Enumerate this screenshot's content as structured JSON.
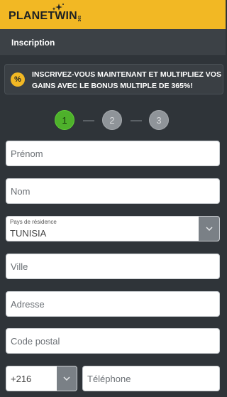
{
  "brand": {
    "name": "PLANETWIN",
    "suffix": "365",
    "accent_color": "#f2b824"
  },
  "header": {
    "title": "Inscription"
  },
  "promo": {
    "icon": "percent-badge-icon",
    "icon_glyph": "%",
    "text": "INSCRIVEZ-VOUS MAINTENANT ET MULTIPLIEZ VOS GAINS AVEC LE BONUS MULTIPLE DE 365%!"
  },
  "steps": {
    "items": [
      "1",
      "2",
      "3"
    ],
    "active": "1",
    "active_color": "#4eb12b"
  },
  "form": {
    "first_name": {
      "placeholder": "Prénom",
      "value": ""
    },
    "last_name": {
      "placeholder": "Nom",
      "value": ""
    },
    "country": {
      "label": "Pays de résidence",
      "value": "TUNISIA"
    },
    "city": {
      "placeholder": "Ville",
      "value": ""
    },
    "address": {
      "placeholder": "Adresse",
      "value": ""
    },
    "postal_code": {
      "placeholder": "Code postal",
      "value": ""
    },
    "phone_code": {
      "value": "+216"
    },
    "phone": {
      "placeholder": "Téléphone",
      "value": ""
    }
  }
}
